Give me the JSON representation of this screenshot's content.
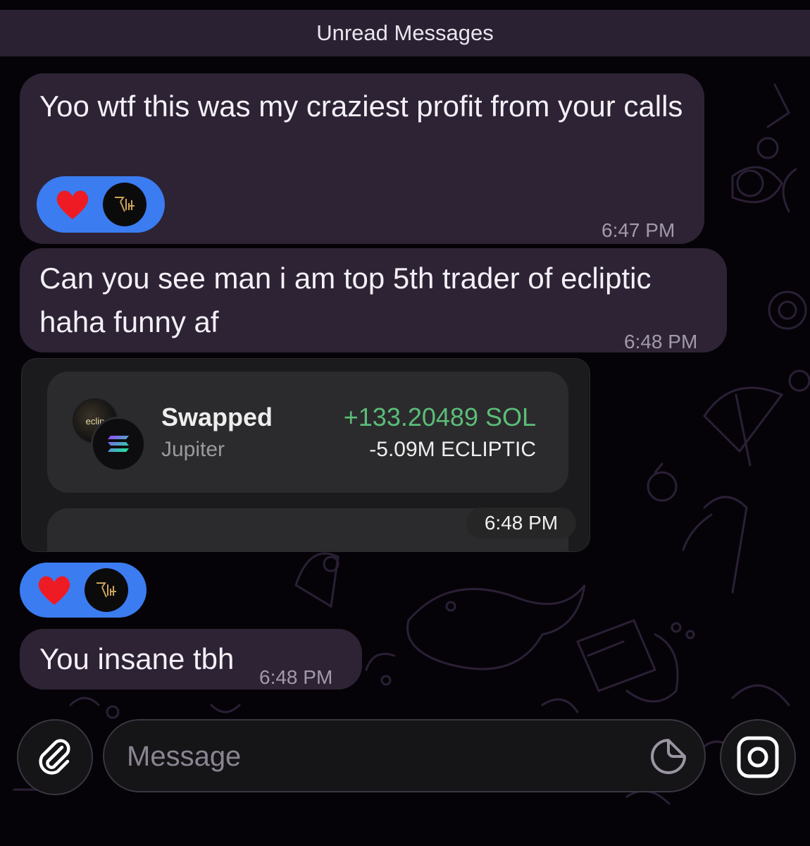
{
  "unread_label": "Unread Messages",
  "messages": [
    {
      "text": "Yoo wtf this was my craziest profit from your calls",
      "time": "6:47 PM",
      "reactions": [
        "heart",
        "avatar"
      ]
    },
    {
      "text": "Can you see man i am top 5th trader of ecliptic haha funny af",
      "time": "6:48 PM"
    },
    {
      "type": "image",
      "time": "6:48 PM",
      "reactions": [
        "heart",
        "avatar"
      ],
      "swap": {
        "title": "Swapped",
        "platform": "Jupiter",
        "plus": "+133.20489 SOL",
        "minus": "-5.09M ECLIPTIC",
        "token_back_label": "eclip"
      }
    },
    {
      "text": "You insane tbh",
      "time": "6:48 PM"
    }
  ],
  "composer": {
    "placeholder": "Message"
  },
  "colors": {
    "reaction_bg": "#3b7cf1",
    "bubble_bg": "#2d2334",
    "positive": "#5bbd78"
  },
  "icons": [
    "heart-icon",
    "avatar-icon",
    "solana-icon",
    "paperclip-icon",
    "sticker-icon",
    "camera-icon"
  ]
}
